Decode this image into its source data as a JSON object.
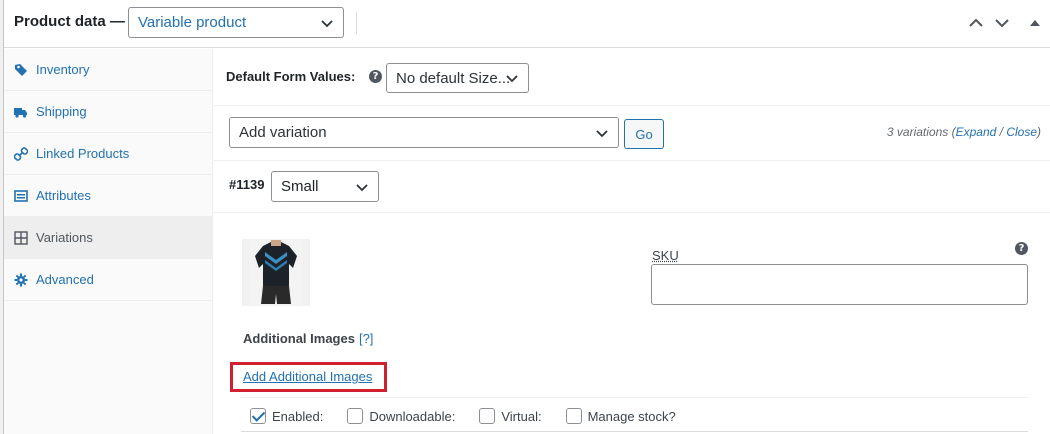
{
  "header": {
    "title": "Product data —",
    "product_type": "Variable product"
  },
  "sidebar": {
    "items": [
      {
        "label": "Inventory",
        "icon": "tag-icon"
      },
      {
        "label": "Shipping",
        "icon": "truck-icon"
      },
      {
        "label": "Linked Products",
        "icon": "link-icon"
      },
      {
        "label": "Attributes",
        "icon": "list-icon"
      },
      {
        "label": "Variations",
        "icon": "grid-icon",
        "active": true
      },
      {
        "label": "Advanced",
        "icon": "gear-icon"
      }
    ]
  },
  "defaults": {
    "label": "Default Form Values:",
    "help": "?",
    "selected": "No default Size..."
  },
  "variations_toolbar": {
    "action_selected": "Add variation",
    "go_label": "Go",
    "count_text": "3 variations (",
    "expand_label": "Expand",
    "slash": " / ",
    "close_label": "Close",
    "close_paren": ")"
  },
  "variation": {
    "id": "#1139",
    "size": "Small",
    "sku_label": "SKU",
    "sku_help": "?",
    "sku_value": "",
    "additional_images_title": "Additional Images",
    "additional_images_help": "[?]",
    "add_images_link": "Add Additional Images",
    "options": [
      {
        "label": "Enabled:",
        "checked": true
      },
      {
        "label": "Downloadable:",
        "checked": false
      },
      {
        "label": "Virtual:",
        "checked": false
      },
      {
        "label": "Manage stock?",
        "checked": false
      }
    ]
  },
  "colors": {
    "link": "#2271b1",
    "highlight": "#d1202f"
  }
}
